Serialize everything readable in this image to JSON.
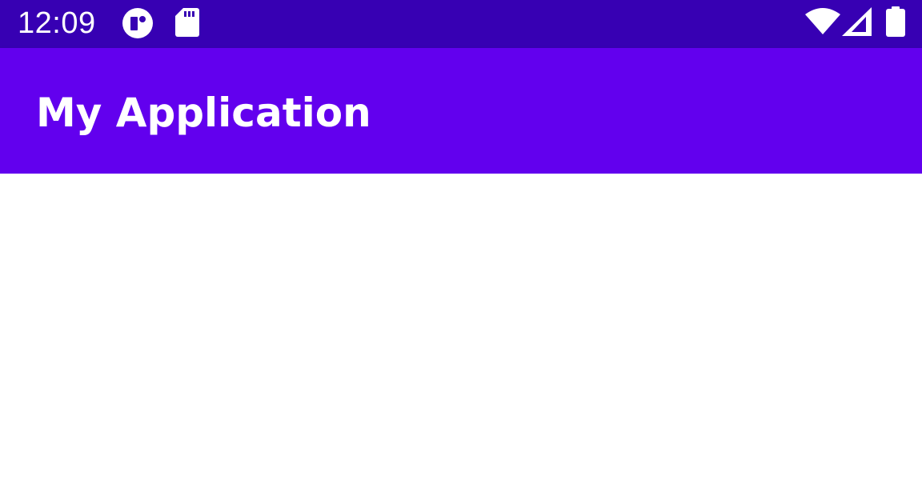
{
  "status_bar": {
    "time": "12:09",
    "left_icons": [
      "notification-app-icon",
      "sd-card-icon"
    ],
    "right_icons": [
      "wifi-icon",
      "cell-signal-icon",
      "battery-icon"
    ]
  },
  "app_bar": {
    "title": "My Application"
  },
  "colors": {
    "status_bar": "#3700b3",
    "app_bar": "#6200ee",
    "background": "#ffffff",
    "on_primary": "#ffffff"
  }
}
